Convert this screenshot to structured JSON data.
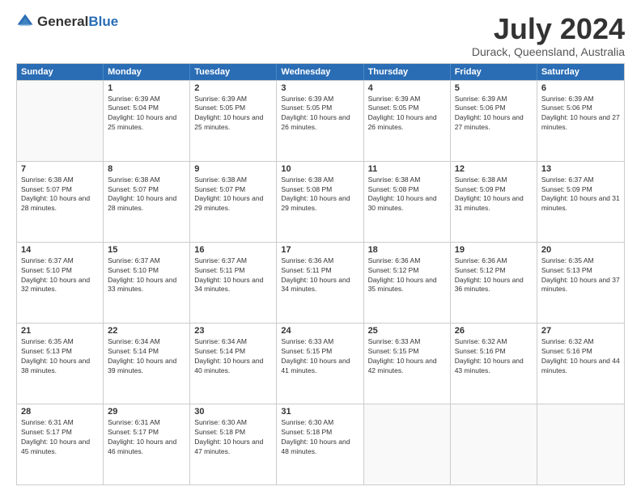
{
  "logo": {
    "general": "General",
    "blue": "Blue"
  },
  "header": {
    "month": "July 2024",
    "location": "Durack, Queensland, Australia"
  },
  "weekdays": [
    "Sunday",
    "Monday",
    "Tuesday",
    "Wednesday",
    "Thursday",
    "Friday",
    "Saturday"
  ],
  "weeks": [
    [
      {
        "day": "",
        "sunrise": "",
        "sunset": "",
        "daylight": ""
      },
      {
        "day": "1",
        "sunrise": "Sunrise: 6:39 AM",
        "sunset": "Sunset: 5:04 PM",
        "daylight": "Daylight: 10 hours and 25 minutes."
      },
      {
        "day": "2",
        "sunrise": "Sunrise: 6:39 AM",
        "sunset": "Sunset: 5:05 PM",
        "daylight": "Daylight: 10 hours and 25 minutes."
      },
      {
        "day": "3",
        "sunrise": "Sunrise: 6:39 AM",
        "sunset": "Sunset: 5:05 PM",
        "daylight": "Daylight: 10 hours and 26 minutes."
      },
      {
        "day": "4",
        "sunrise": "Sunrise: 6:39 AM",
        "sunset": "Sunset: 5:05 PM",
        "daylight": "Daylight: 10 hours and 26 minutes."
      },
      {
        "day": "5",
        "sunrise": "Sunrise: 6:39 AM",
        "sunset": "Sunset: 5:06 PM",
        "daylight": "Daylight: 10 hours and 27 minutes."
      },
      {
        "day": "6",
        "sunrise": "Sunrise: 6:39 AM",
        "sunset": "Sunset: 5:06 PM",
        "daylight": "Daylight: 10 hours and 27 minutes."
      }
    ],
    [
      {
        "day": "7",
        "sunrise": "Sunrise: 6:38 AM",
        "sunset": "Sunset: 5:07 PM",
        "daylight": "Daylight: 10 hours and 28 minutes."
      },
      {
        "day": "8",
        "sunrise": "Sunrise: 6:38 AM",
        "sunset": "Sunset: 5:07 PM",
        "daylight": "Daylight: 10 hours and 28 minutes."
      },
      {
        "day": "9",
        "sunrise": "Sunrise: 6:38 AM",
        "sunset": "Sunset: 5:07 PM",
        "daylight": "Daylight: 10 hours and 29 minutes."
      },
      {
        "day": "10",
        "sunrise": "Sunrise: 6:38 AM",
        "sunset": "Sunset: 5:08 PM",
        "daylight": "Daylight: 10 hours and 29 minutes."
      },
      {
        "day": "11",
        "sunrise": "Sunrise: 6:38 AM",
        "sunset": "Sunset: 5:08 PM",
        "daylight": "Daylight: 10 hours and 30 minutes."
      },
      {
        "day": "12",
        "sunrise": "Sunrise: 6:38 AM",
        "sunset": "Sunset: 5:09 PM",
        "daylight": "Daylight: 10 hours and 31 minutes."
      },
      {
        "day": "13",
        "sunrise": "Sunrise: 6:37 AM",
        "sunset": "Sunset: 5:09 PM",
        "daylight": "Daylight: 10 hours and 31 minutes."
      }
    ],
    [
      {
        "day": "14",
        "sunrise": "Sunrise: 6:37 AM",
        "sunset": "Sunset: 5:10 PM",
        "daylight": "Daylight: 10 hours and 32 minutes."
      },
      {
        "day": "15",
        "sunrise": "Sunrise: 6:37 AM",
        "sunset": "Sunset: 5:10 PM",
        "daylight": "Daylight: 10 hours and 33 minutes."
      },
      {
        "day": "16",
        "sunrise": "Sunrise: 6:37 AM",
        "sunset": "Sunset: 5:11 PM",
        "daylight": "Daylight: 10 hours and 34 minutes."
      },
      {
        "day": "17",
        "sunrise": "Sunrise: 6:36 AM",
        "sunset": "Sunset: 5:11 PM",
        "daylight": "Daylight: 10 hours and 34 minutes."
      },
      {
        "day": "18",
        "sunrise": "Sunrise: 6:36 AM",
        "sunset": "Sunset: 5:12 PM",
        "daylight": "Daylight: 10 hours and 35 minutes."
      },
      {
        "day": "19",
        "sunrise": "Sunrise: 6:36 AM",
        "sunset": "Sunset: 5:12 PM",
        "daylight": "Daylight: 10 hours and 36 minutes."
      },
      {
        "day": "20",
        "sunrise": "Sunrise: 6:35 AM",
        "sunset": "Sunset: 5:13 PM",
        "daylight": "Daylight: 10 hours and 37 minutes."
      }
    ],
    [
      {
        "day": "21",
        "sunrise": "Sunrise: 6:35 AM",
        "sunset": "Sunset: 5:13 PM",
        "daylight": "Daylight: 10 hours and 38 minutes."
      },
      {
        "day": "22",
        "sunrise": "Sunrise: 6:34 AM",
        "sunset": "Sunset: 5:14 PM",
        "daylight": "Daylight: 10 hours and 39 minutes."
      },
      {
        "day": "23",
        "sunrise": "Sunrise: 6:34 AM",
        "sunset": "Sunset: 5:14 PM",
        "daylight": "Daylight: 10 hours and 40 minutes."
      },
      {
        "day": "24",
        "sunrise": "Sunrise: 6:33 AM",
        "sunset": "Sunset: 5:15 PM",
        "daylight": "Daylight: 10 hours and 41 minutes."
      },
      {
        "day": "25",
        "sunrise": "Sunrise: 6:33 AM",
        "sunset": "Sunset: 5:15 PM",
        "daylight": "Daylight: 10 hours and 42 minutes."
      },
      {
        "day": "26",
        "sunrise": "Sunrise: 6:32 AM",
        "sunset": "Sunset: 5:16 PM",
        "daylight": "Daylight: 10 hours and 43 minutes."
      },
      {
        "day": "27",
        "sunrise": "Sunrise: 6:32 AM",
        "sunset": "Sunset: 5:16 PM",
        "daylight": "Daylight: 10 hours and 44 minutes."
      }
    ],
    [
      {
        "day": "28",
        "sunrise": "Sunrise: 6:31 AM",
        "sunset": "Sunset: 5:17 PM",
        "daylight": "Daylight: 10 hours and 45 minutes."
      },
      {
        "day": "29",
        "sunrise": "Sunrise: 6:31 AM",
        "sunset": "Sunset: 5:17 PM",
        "daylight": "Daylight: 10 hours and 46 minutes."
      },
      {
        "day": "30",
        "sunrise": "Sunrise: 6:30 AM",
        "sunset": "Sunset: 5:18 PM",
        "daylight": "Daylight: 10 hours and 47 minutes."
      },
      {
        "day": "31",
        "sunrise": "Sunrise: 6:30 AM",
        "sunset": "Sunset: 5:18 PM",
        "daylight": "Daylight: 10 hours and 48 minutes."
      },
      {
        "day": "",
        "sunrise": "",
        "sunset": "",
        "daylight": ""
      },
      {
        "day": "",
        "sunrise": "",
        "sunset": "",
        "daylight": ""
      },
      {
        "day": "",
        "sunrise": "",
        "sunset": "",
        "daylight": ""
      }
    ]
  ]
}
